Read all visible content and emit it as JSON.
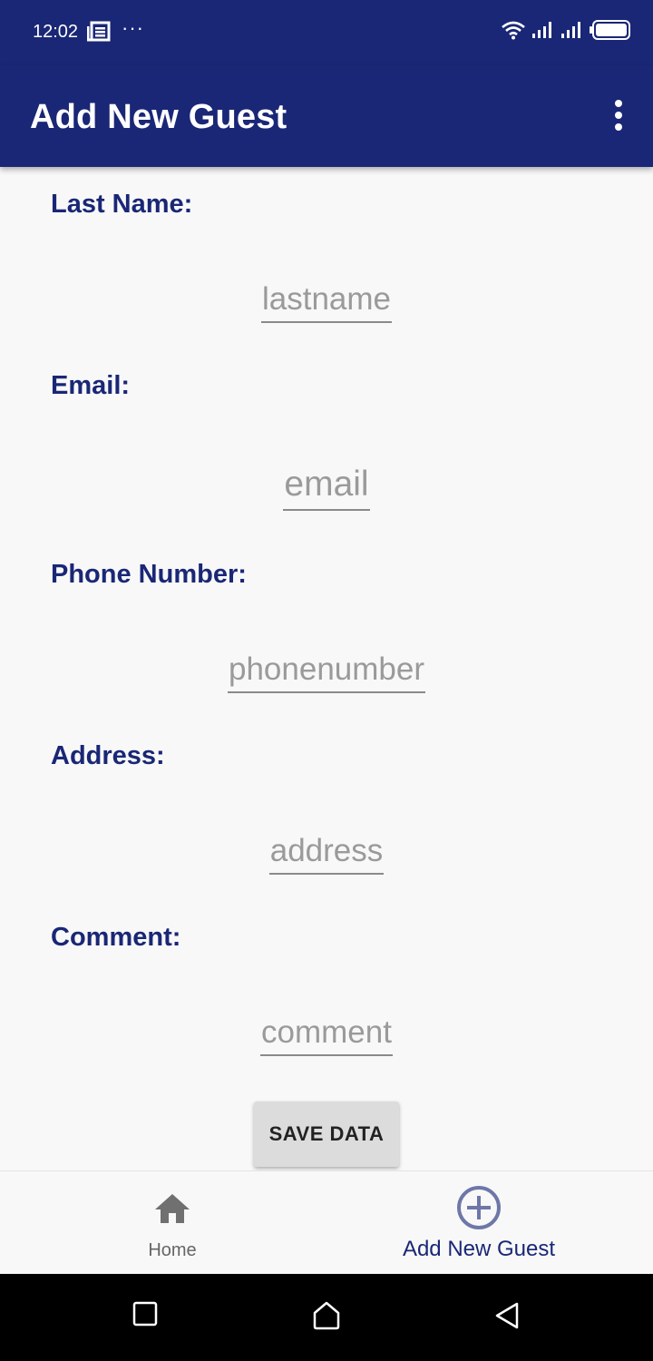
{
  "status_bar": {
    "time": "12:02",
    "dots": "···"
  },
  "app_bar": {
    "title": "Add New Guest"
  },
  "form": {
    "fields": [
      {
        "label": "Last Name:",
        "placeholder": "lastname"
      },
      {
        "label": "Email:",
        "placeholder": "email"
      },
      {
        "label": "Phone Number:",
        "placeholder": "phonenumber"
      },
      {
        "label": "Address:",
        "placeholder": "address"
      },
      {
        "label": "Comment:",
        "placeholder": "comment"
      }
    ],
    "save_label": "SAVE DATA"
  },
  "bottom_nav": {
    "items": [
      {
        "label": "Home",
        "icon": "home-icon"
      },
      {
        "label": "Add New Guest",
        "icon": "add-circle-icon"
      }
    ]
  },
  "colors": {
    "primary": "#1a2776",
    "background": "#f8f8f8",
    "placeholder": "#9a9a9a",
    "button": "#dcdcdc"
  }
}
